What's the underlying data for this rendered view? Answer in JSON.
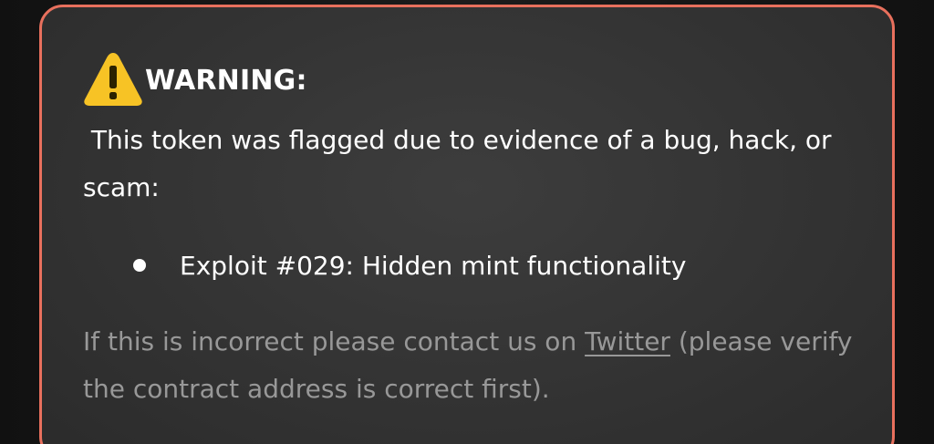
{
  "warning": {
    "icon": "warning-triangle-icon",
    "title": "WARNING:",
    "description": " This token was flagged due to evidence of a bug, hack, or scam:",
    "exploits": [
      {
        "text": "Exploit #029: Hidden mint functionality"
      }
    ],
    "footer": {
      "before_link": "If this is incorrect please contact us on ",
      "link_label": "Twitter",
      "after_link": " (please verify the contract address is correct first)."
    }
  },
  "colors": {
    "border": "#e8705d",
    "icon_yellow": "#f7c325",
    "card_background": "#333333",
    "muted_text": "#989898"
  }
}
